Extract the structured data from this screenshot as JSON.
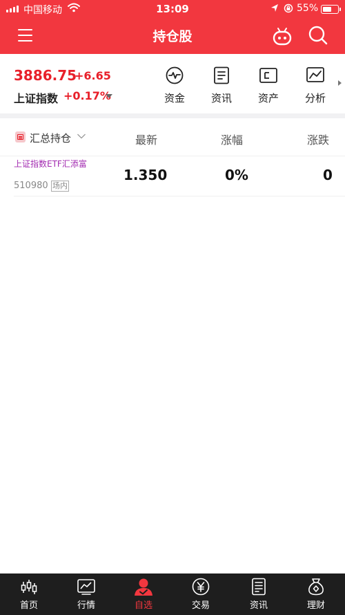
{
  "status_bar": {
    "carrier": "中国移动",
    "time": "13:09",
    "battery": "55%"
  },
  "nav": {
    "title": "持仓股",
    "icons": [
      "menu-icon",
      "robot-icon",
      "search-icon"
    ]
  },
  "index": {
    "value": "3886.75",
    "change": "+6.65",
    "name": "上证指数",
    "change_pct": "+0.17%"
  },
  "quick_links": [
    {
      "label": "资金",
      "icon": "pulse-icon"
    },
    {
      "label": "资讯",
      "icon": "document-icon"
    },
    {
      "label": "资产",
      "icon": "wallet-icon"
    },
    {
      "label": "分析",
      "icon": "chart-icon"
    }
  ],
  "table": {
    "group_label": "汇总持仓",
    "columns": [
      "最新",
      "涨幅",
      "涨跌"
    ],
    "rows": [
      {
        "name": "上证指数ETF汇添富",
        "code": "510980",
        "tag": "场内",
        "latest": "1.350",
        "change_pct": "0%",
        "change": "0"
      }
    ]
  },
  "tabbar": {
    "items": [
      {
        "label": "首页",
        "icon": "candlestick-icon",
        "active": false
      },
      {
        "label": "行情",
        "icon": "market-chart-icon",
        "active": false
      },
      {
        "label": "自选",
        "icon": "user-check-icon",
        "active": true
      },
      {
        "label": "交易",
        "icon": "yen-coin-icon",
        "active": false
      },
      {
        "label": "资讯",
        "icon": "news-icon",
        "active": false
      },
      {
        "label": "理财",
        "icon": "money-bag-icon",
        "active": false
      }
    ]
  },
  "colors": {
    "brand_red": "#f2373f",
    "rise_red": "#e8202a",
    "fund_name_purple": "#a22ab0",
    "tabbar_bg": "#1e1e1e"
  }
}
